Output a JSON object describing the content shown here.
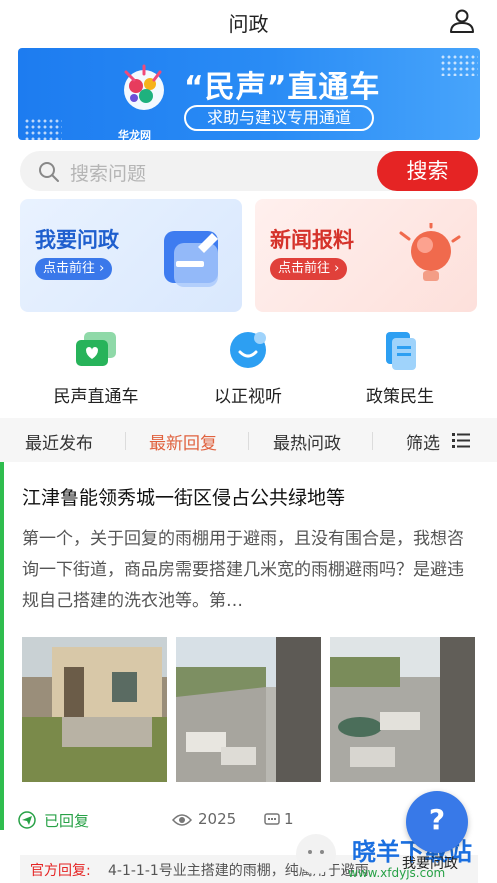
{
  "header": {
    "title": "问政"
  },
  "banner": {
    "brand": "华龙网",
    "headline": "“民声”直通车",
    "subtitle": "求助与建议专用通道"
  },
  "search": {
    "placeholder": "搜索问题",
    "button": "搜索"
  },
  "cards": [
    {
      "title": "我要问政",
      "action": "点击前往 ›"
    },
    {
      "title": "新闻报料",
      "action": "点击前往 ›"
    }
  ],
  "quick_links": [
    {
      "label": "民声直通车",
      "icon": "chat-bubbles-icon"
    },
    {
      "label": "以正视听",
      "icon": "face-bubble-icon"
    },
    {
      "label": "政策民生",
      "icon": "document-icon"
    }
  ],
  "filters": {
    "tabs": [
      "最近发布",
      "最新回复",
      "最热问政"
    ],
    "active": "最新回复",
    "filter_label": "筛选"
  },
  "post": {
    "title": "江津鲁能领秀城一街区侵占公共绿地等",
    "body": "第一个，关于回复的雨棚用于避雨，且没有围合是，我想咨询一下街道，商品房需要搭建几米宽的雨棚避雨吗？是避违规自己搭建的洗衣池等。第…",
    "status": "已回复",
    "views": "2025",
    "comments": "1",
    "reply_label": "官方回复:",
    "reply_text": "4-1-1-1号业主搭建的雨棚，纯属用于避雨"
  },
  "fab": {
    "label": "我要问政"
  },
  "watermark": {
    "text": "晓羊下载站",
    "url": "www.xfdyjs.com"
  },
  "colors": {
    "accent_red": "#e52424",
    "brand_blue": "#1d7cf0",
    "replied_green": "#27a146",
    "active_tab": "#e0623f"
  }
}
